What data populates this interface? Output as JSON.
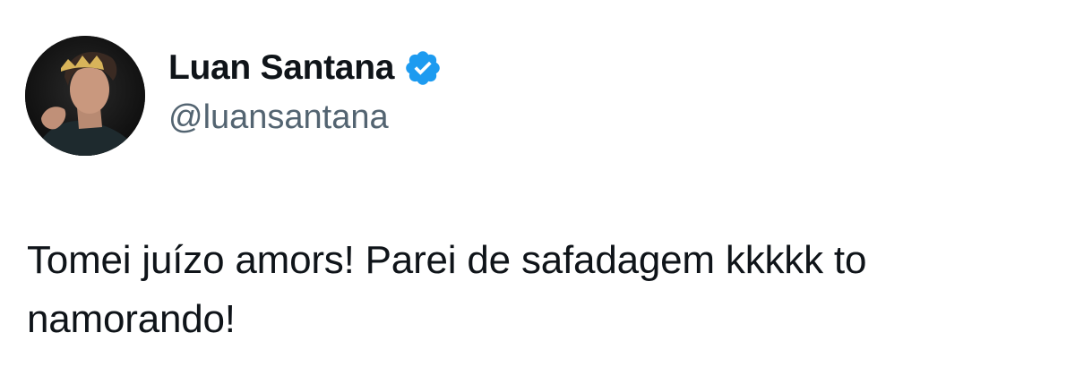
{
  "author": {
    "display_name": "Luan Santana",
    "handle": "@luansantana",
    "verified_icon": "verified-badge-icon",
    "avatar_icon": "profile-photo"
  },
  "tweet": {
    "text": "Tomei juízo amors! Parei de safadagem kkkkk to namorando!"
  },
  "colors": {
    "verified": "#1d9bf0",
    "text": "#0f1419",
    "secondary": "#536471"
  }
}
